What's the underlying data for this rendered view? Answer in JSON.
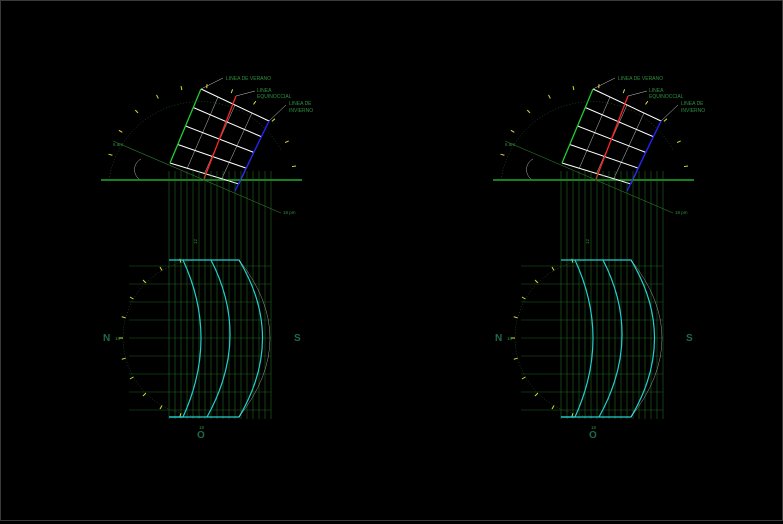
{
  "colors": {
    "background": "#000000",
    "horizon": "#22cc33",
    "plate": "#ffffff",
    "equinox_line": "#ff2222",
    "winter_line": "#2222ff",
    "summer_line": "#22cc33",
    "projection": "#2a7a2a",
    "arcs": "#22d0d0",
    "ticks": "#dddd33",
    "text": "#2f8f3f"
  },
  "drawings": [
    {
      "labels": {
        "summer": "LINEA DE VERANO",
        "equinox_1": "LINEA",
        "equinox_2": "EQUINOCCIAL",
        "winter_1": "LINEA DE",
        "winter_2": "INVIERNO"
      },
      "time_left": "6 am",
      "time_right": "18 pm",
      "hour_label": "12",
      "cardinals": {
        "north": "N",
        "south": "S",
        "west": "O"
      },
      "small_tags": {
        "north": "18",
        "west": "18"
      }
    },
    {
      "labels": {
        "summer": "LINEA DE VERANO",
        "equinox_1": "LINEA",
        "equinox_2": "EQUINOCCIAL",
        "winter_1": "LINEA DE",
        "winter_2": "INVIERNO"
      },
      "time_left": "6 am",
      "time_right": "18 pm",
      "hour_label": "12",
      "cardinals": {
        "north": "N",
        "south": "S",
        "west": "O"
      },
      "small_tags": {
        "north": "18",
        "west": "18"
      }
    }
  ]
}
